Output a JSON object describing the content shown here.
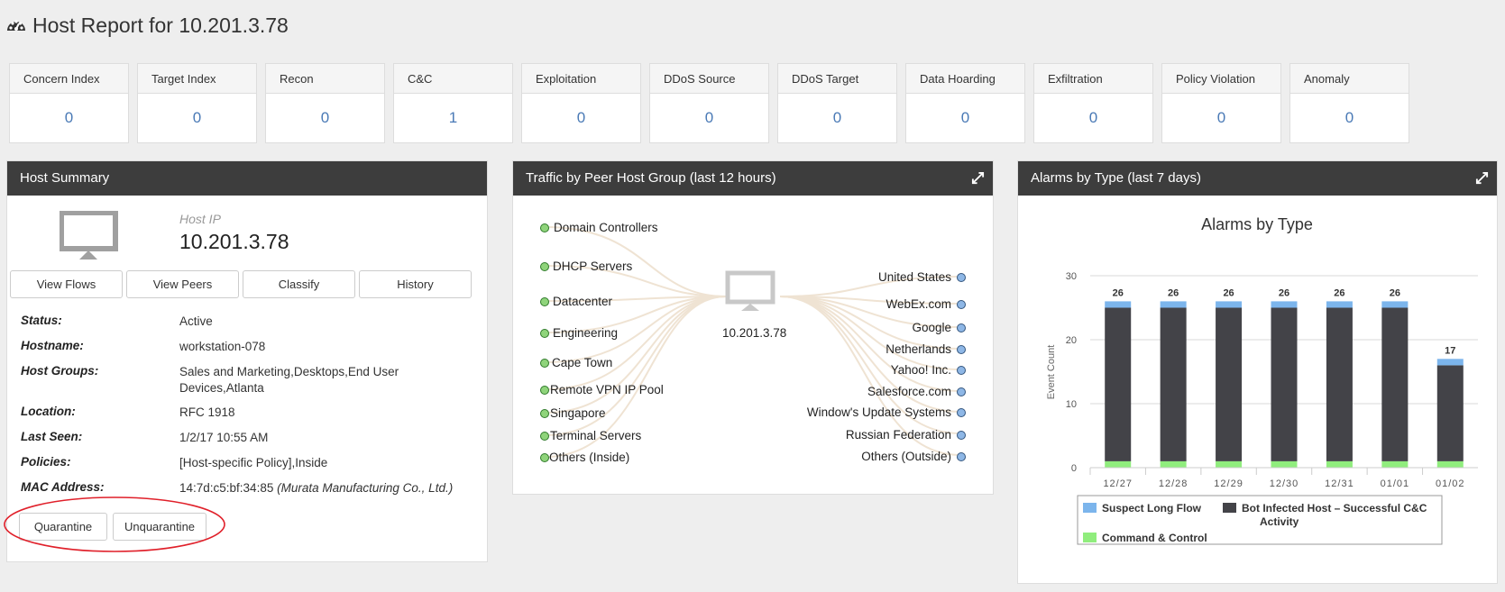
{
  "page": {
    "title": "Host Report for 10.201.3.78"
  },
  "indices": [
    {
      "label": "Concern Index",
      "value": "0"
    },
    {
      "label": "Target Index",
      "value": "0"
    },
    {
      "label": "Recon",
      "value": "0"
    },
    {
      "label": "C&C",
      "value": "1"
    },
    {
      "label": "Exploitation",
      "value": "0"
    },
    {
      "label": "DDoS Source",
      "value": "0"
    },
    {
      "label": "DDoS Target",
      "value": "0"
    },
    {
      "label": "Data Hoarding",
      "value": "0"
    },
    {
      "label": "Exfiltration",
      "value": "0"
    },
    {
      "label": "Policy Violation",
      "value": "0"
    },
    {
      "label": "Anomaly",
      "value": "0"
    }
  ],
  "host_summary": {
    "title": "Host Summary",
    "host_ip_label": "Host IP",
    "host_ip": "10.201.3.78",
    "buttons": {
      "view_flows": "View Flows",
      "view_peers": "View Peers",
      "classify": "Classify",
      "history": "History"
    },
    "fields": {
      "status": {
        "label": "Status:",
        "value": "Active"
      },
      "hostname": {
        "label": "Hostname:",
        "value": "workstation-078"
      },
      "host_groups": {
        "label": "Host Groups:",
        "value_line1": "Sales and Marketing,Desktops,End User",
        "value_line2": "Devices,Atlanta"
      },
      "location": {
        "label": "Location:",
        "value": "RFC 1918"
      },
      "last_seen": {
        "label": "Last Seen:",
        "value": "1/2/17 10:55 AM"
      },
      "policies": {
        "label": "Policies:",
        "value": "[Host-specific Policy],Inside"
      },
      "mac": {
        "label": "MAC Address:",
        "value": "14:7d:c5:bf:34:85",
        "vendor": "(Murata Manufacturing Co., Ltd.)"
      }
    },
    "actions": {
      "quarantine": "Quarantine",
      "unquarantine": "Unquarantine"
    },
    "highlight_color": "#e0202a"
  },
  "traffic": {
    "title": "Traffic by Peer Host Group (last 12 hours)",
    "center_label": "10.201.3.78",
    "inside_groups": [
      "Domain Controllers",
      "DHCP Servers",
      "Datacenter",
      "Engineering",
      "Cape Town",
      "Remote VPN IP Pool",
      "Singapore",
      "Terminal Servers",
      "Others (Inside)"
    ],
    "outside_groups": [
      "United States",
      "WebEx.com",
      "Google",
      "Netherlands",
      "Yahoo! Inc.",
      "Salesforce.com",
      "Window's Update Systems",
      "Russian Federation",
      "Others (Outside)"
    ],
    "colors": {
      "inside": "#8fd47b",
      "outside": "#8eb7e6",
      "link": "#f0e6d8"
    }
  },
  "alarms": {
    "title": "Alarms by Type (last 7 days)",
    "chart_data": {
      "type": "bar",
      "stacked": true,
      "title": "Alarms by Type",
      "ylabel": "Event Count",
      "xlabel": "",
      "ylim": [
        0,
        30
      ],
      "yticks": [
        0,
        10,
        20,
        30
      ],
      "categories": [
        "12/27",
        "12/28",
        "12/29",
        "12/30",
        "12/31",
        "01/01",
        "01/02"
      ],
      "totals": [
        "26",
        "26",
        "26",
        "26",
        "26",
        "26",
        "17"
      ],
      "series": [
        {
          "name": "Command & Control",
          "color": "#90ed7d",
          "values": [
            1,
            1,
            1,
            1,
            1,
            1,
            1
          ]
        },
        {
          "name": "Bot Infected Host - Successful C&C Activity",
          "color": "#434348",
          "values": [
            24,
            24,
            24,
            24,
            24,
            24,
            15
          ]
        },
        {
          "name": "Suspect Long Flow",
          "color": "#7cb5ec",
          "values": [
            1,
            1,
            1,
            1,
            1,
            1,
            1
          ]
        }
      ],
      "legend": {
        "placement": "bottom",
        "suspect": "Suspect Long Flow",
        "bot_line1": "Bot Infected Host – Successful C&C",
        "bot_line2": "Activity",
        "cc": "Command & Control"
      }
    }
  }
}
